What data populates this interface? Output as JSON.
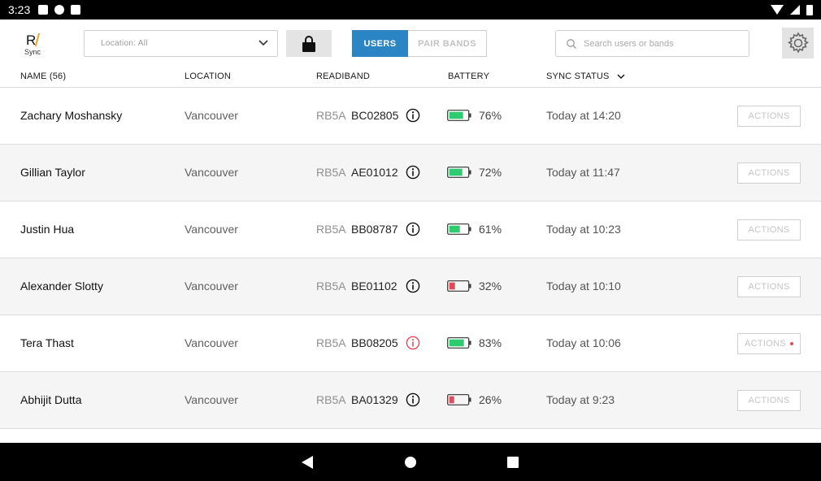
{
  "status_bar": {
    "time": "3:23"
  },
  "app": {
    "logo_letter": "R",
    "logo_sub": "Sync"
  },
  "toolbar": {
    "location_select": "Location: All",
    "tabs": [
      {
        "label": "USERS",
        "active": true
      },
      {
        "label": "PAIR BANDS",
        "active": false
      }
    ],
    "search_placeholder": "Search users or bands"
  },
  "table": {
    "headers": {
      "name": "NAME (56)",
      "location": "LOCATION",
      "readiband": "READIBAND",
      "battery": "BATTERY",
      "sync_status": "SYNC STATUS"
    },
    "rows": [
      {
        "name": "Zachary Moshansky",
        "location": "Vancouver",
        "model": "RB5A",
        "band": "BC02805",
        "battery_pct": 76,
        "battery_label": "76%",
        "battery_color": "#2ecc71",
        "info_color": "#111111",
        "sync": "Today at 14:20",
        "action": "ACTIONS",
        "alert": false
      },
      {
        "name": "Gillian Taylor",
        "location": "Vancouver",
        "model": "RB5A",
        "band": "AE01012",
        "battery_pct": 72,
        "battery_label": "72%",
        "battery_color": "#2ecc71",
        "info_color": "#111111",
        "sync": "Today at 11:47",
        "action": "ACTIONS",
        "alert": false
      },
      {
        "name": "Justin Hua",
        "location": "Vancouver",
        "model": "RB5A",
        "band": "BB08787",
        "battery_pct": 61,
        "battery_label": "61%",
        "battery_color": "#2ecc71",
        "info_color": "#111111",
        "sync": "Today at 10:23",
        "action": "ACTIONS",
        "alert": false
      },
      {
        "name": "Alexander Slotty",
        "location": "Vancouver",
        "model": "RB5A",
        "band": "BE01102",
        "battery_pct": 32,
        "battery_label": "32%",
        "battery_color": "#e14b5a",
        "info_color": "#111111",
        "sync": "Today at 10:10",
        "action": "ACTIONS",
        "alert": false
      },
      {
        "name": "Tera Thast",
        "location": "Vancouver",
        "model": "RB5A",
        "band": "BB08205",
        "battery_pct": 83,
        "battery_label": "83%",
        "battery_color": "#2ecc71",
        "info_color": "#e14b5a",
        "sync": "Today at 10:06",
        "action": "ACTIONS",
        "alert": true
      },
      {
        "name": "Abhijit Dutta",
        "location": "Vancouver",
        "model": "RB5A",
        "band": "BA01329",
        "battery_pct": 26,
        "battery_label": "26%",
        "battery_color": "#e14b5a",
        "info_color": "#111111",
        "sync": "Today at 9:23",
        "action": "ACTIONS",
        "alert": false
      }
    ]
  },
  "colors": {
    "accent": "#2b84c3",
    "battery_ok": "#2ecc71",
    "battery_low": "#e14b5a"
  }
}
